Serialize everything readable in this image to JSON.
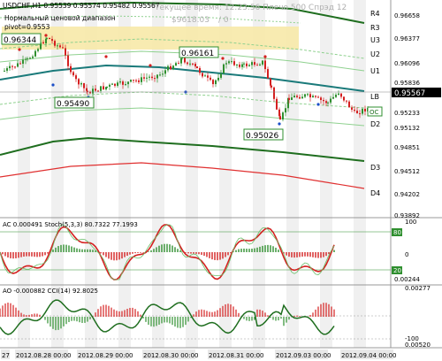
{
  "header": {
    "symbol_line": "USDCHF,H1  0.95539 0.95574 0.95482 0.95567",
    "info_line": "Текущее время: 12:23:56 Плечо 500 Спрэд 12",
    "balance": "$9618.03",
    "counter": "/ 0",
    "range_label": "Нормальный ценовой диапазон",
    "pivot_label": "pivot=0.9553"
  },
  "price_callouts": {
    "high1": "0.96344",
    "high2": "0.96161",
    "low1": "0.95490",
    "low2": "0.95026",
    "current": "0.95567"
  },
  "levels": [
    "R4",
    "R3",
    "U3",
    "U2",
    "U1",
    "LB",
    "D1",
    "D2",
    "D3",
    "D4"
  ],
  "price_axis": [
    "0.96658",
    "0.96377",
    "0.96096",
    "0.95836",
    "0.95567",
    "0.95233",
    "0.95132",
    "0.94851",
    "0.94512",
    "0.94202",
    "0.93892"
  ],
  "oc_label": "OC",
  "stoch_panel": {
    "label": "AC 0.000491  Stoch(5,3,3) 80.7322 77.1993",
    "axis": [
      "100",
      "80",
      "20",
      "0",
      "0.00244"
    ]
  },
  "cci_panel": {
    "label": "AO -0.000882  CCI(14) 92.8025",
    "axis": [
      "0.00277",
      "-100",
      "0.00520"
    ]
  },
  "time_axis": [
    "27",
    "2012.08.28 00:00",
    "2012.08.29 00:00",
    "2012.08.30 00:00",
    "2012.08.31 00:00",
    "2012.09.03 00:00",
    "2012.09.04 00:00"
  ],
  "colors": {
    "bull": "#2f8f2f",
    "bear": "#d42020",
    "band_dark": "#1f6e1f",
    "band_light": "#8fd18f",
    "teal": "#1a7a7a",
    "red_line": "#e03030",
    "stripe": "#ececec",
    "highlight": "#f7e9a8"
  }
}
